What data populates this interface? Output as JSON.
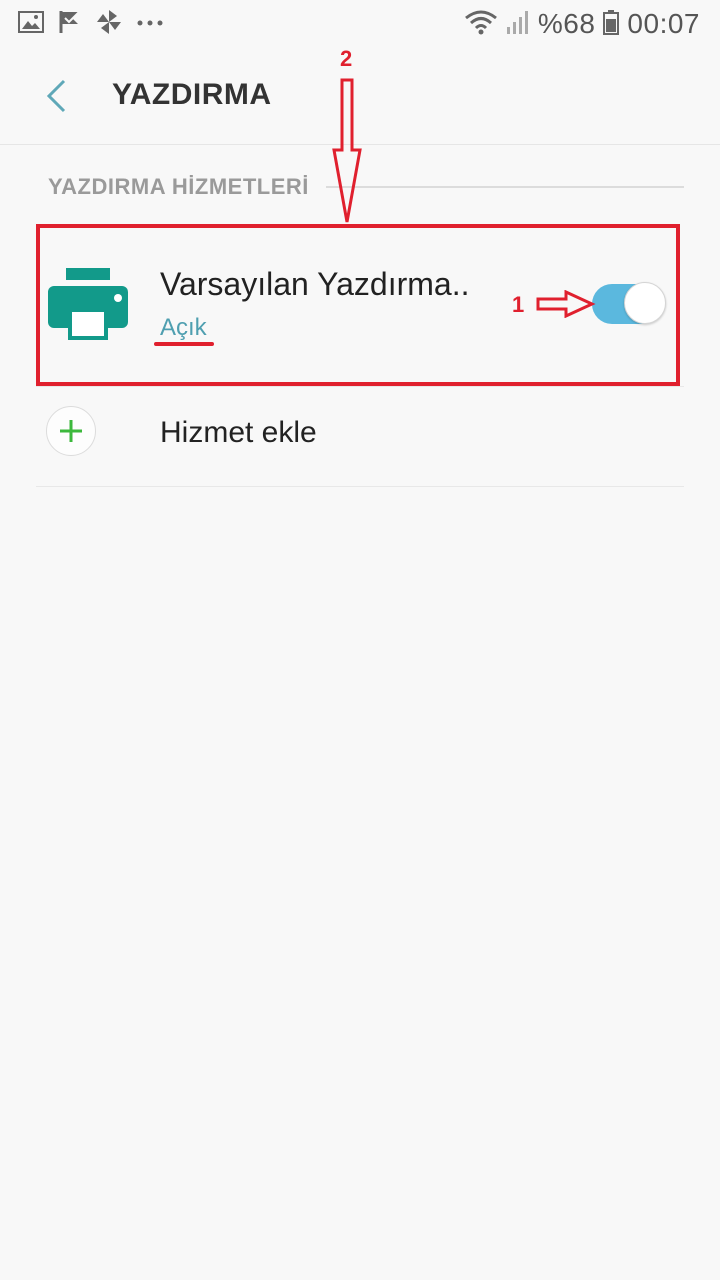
{
  "status_bar": {
    "battery": "%68",
    "time": "00:07",
    "left_icons": [
      "image-icon",
      "check-flag-icon",
      "pinwheel-icon",
      "more-dots-icon"
    ],
    "right_icons": [
      "wifi-icon",
      "signal-icon",
      "battery-icon"
    ]
  },
  "header": {
    "title": "YAZDIRMA",
    "back_icon": "chevron-left-icon"
  },
  "section": {
    "label": "YAZDIRMA HİZMETLERİ"
  },
  "services": [
    {
      "name": "Varsayılan Yazdırma..",
      "status": "Açık",
      "enabled": true,
      "icon": "printer-icon"
    }
  ],
  "add_service": {
    "label": "Hizmet ekle",
    "icon": "plus-icon"
  },
  "annotations": {
    "marker_1": "1",
    "marker_2": "2"
  },
  "colors": {
    "accent_teal": "#129a8a",
    "toggle_on": "#5bb8de",
    "status_text": "#4f9fb0",
    "annotation_red": "#e0202e",
    "plus_green": "#3cb83c"
  }
}
